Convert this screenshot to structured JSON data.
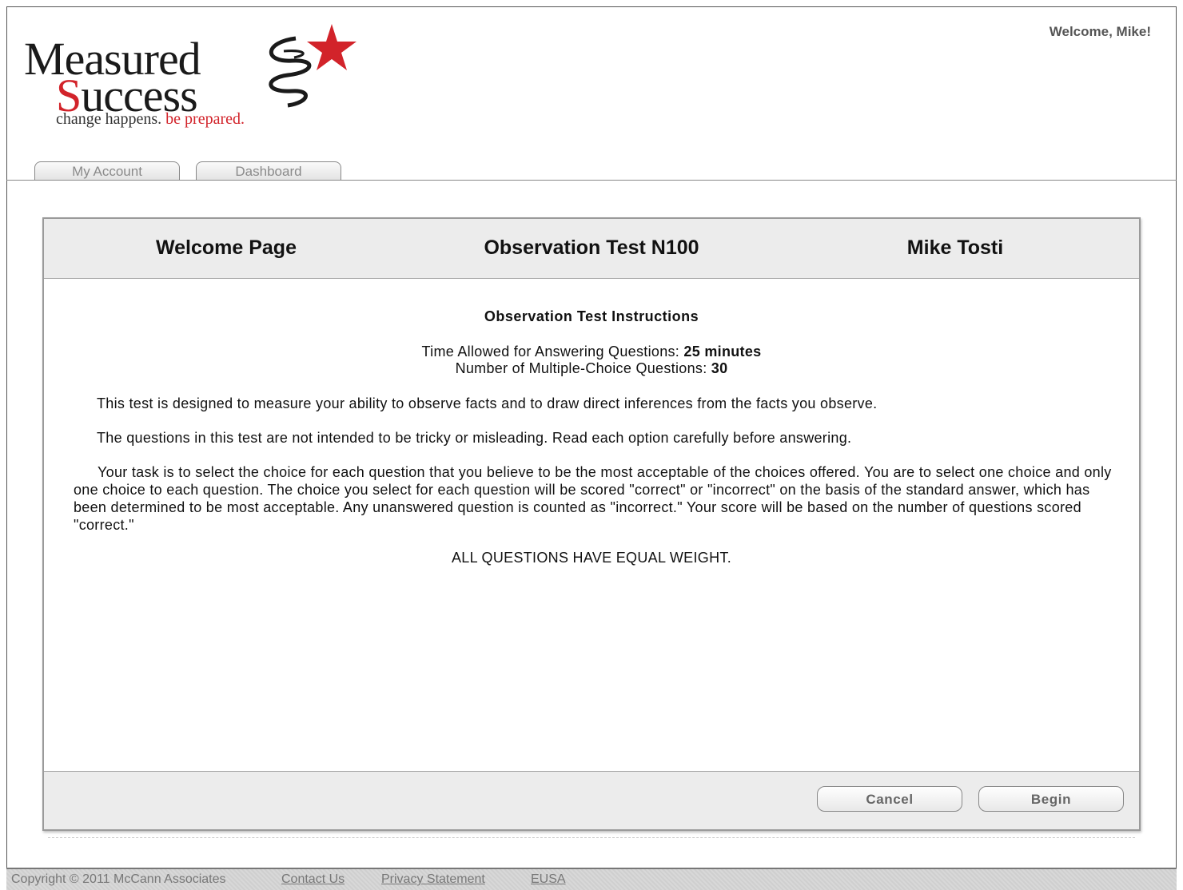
{
  "header": {
    "logo": {
      "line1": "Measured",
      "line2_first": "S",
      "line2_rest": "uccess",
      "tagline_a": "change happens.",
      "tagline_b": "be prepared."
    },
    "welcome": "Welcome, Mike!",
    "tabs": [
      {
        "label": "My Account"
      },
      {
        "label": "Dashboard"
      }
    ]
  },
  "panel": {
    "header": {
      "page": "Welcome Page",
      "test": "Observation Test N100",
      "user": "Mike Tosti"
    },
    "instructions": {
      "title": "Observation Test Instructions",
      "time_label": "Time Allowed for Answering Questions: ",
      "time_value": "25 minutes",
      "count_label": "Number of Multiple-Choice Questions: ",
      "count_value": "30",
      "para1": "This test is designed to measure your ability to observe facts and to draw direct inferences from the facts you observe.",
      "para2": "The questions in this test are not intended to be tricky or misleading. Read each option carefully before answering.",
      "para3": "Your task is to select the choice for each question that you believe to be the most acceptable of the choices offered. You are to select one choice and only one choice to each question. The choice you select for each question will be scored \"correct\" or \"incorrect\" on the basis of the standard answer, which has been determined to be most acceptable. Any unanswered question is counted as \"incorrect.\" Your score will be based on the number of questions scored \"correct.\"",
      "equal_weight": "ALL QUESTIONS HAVE EQUAL WEIGHT."
    },
    "buttons": {
      "cancel": "Cancel",
      "begin": "Begin"
    }
  },
  "footer": {
    "copyright": "Copyright © 2011 McCann Associates",
    "links": [
      "Contact Us",
      "Privacy Statement",
      "EUSA"
    ]
  },
  "colors": {
    "brand_red": "#d2232a",
    "panel_gray": "#ececec"
  }
}
